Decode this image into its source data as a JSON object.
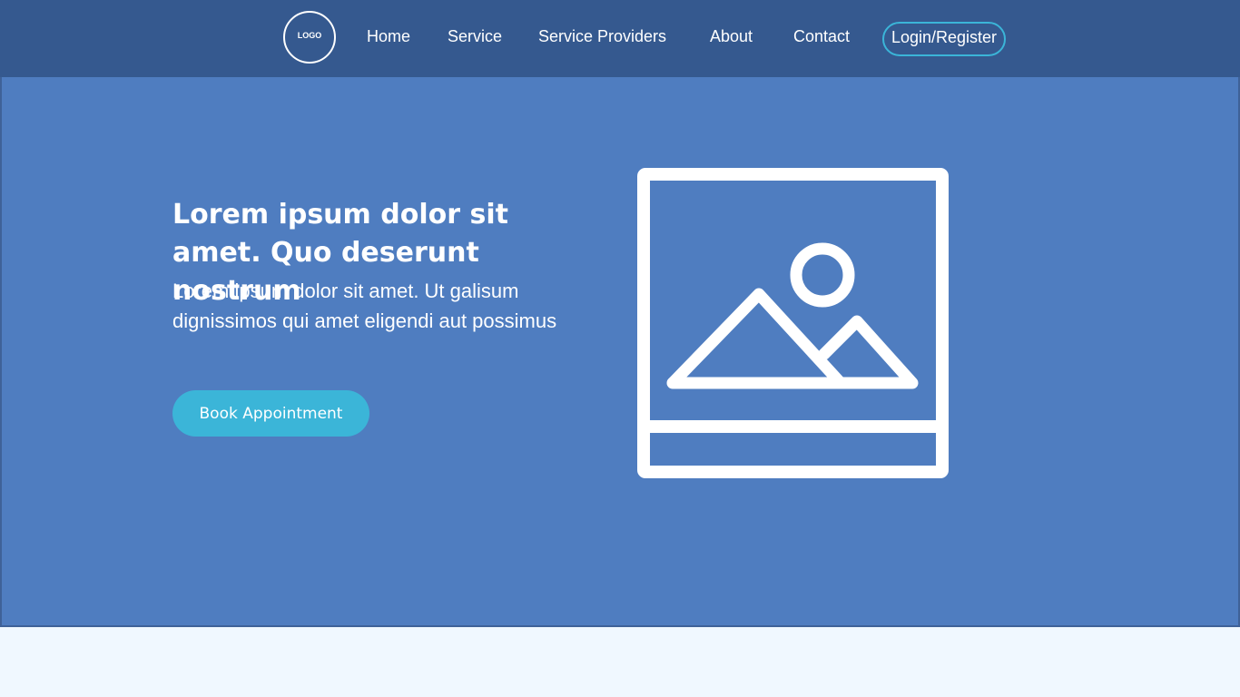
{
  "nav": {
    "logo_text": "LOGO",
    "links": [
      "Home",
      "Service",
      "Service Providers",
      "About",
      "Contact"
    ],
    "login_label": "Login/Register"
  },
  "hero": {
    "title": "Lorem ipsum dolor sit amet. Quo deserunt nostrum",
    "subtitle": "Lorem ipsum dolor sit amet. Ut galisum dignissimos qui amet eligendi aut possimus",
    "cta_label": "Book Appointment",
    "image_icon": "image-placeholder-icon"
  },
  "colors": {
    "navbar": "#35598F",
    "hero": "#4F7DC0",
    "accent": "#3BB5D8",
    "page": "#F0F8FF"
  }
}
